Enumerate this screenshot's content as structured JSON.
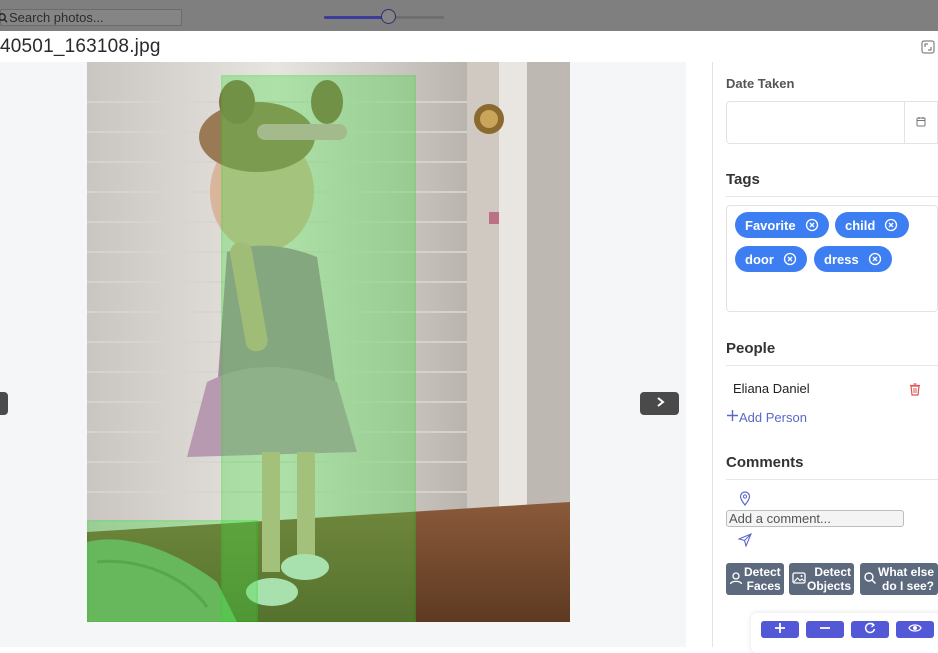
{
  "search": {
    "placeholder": "Search photos...",
    "icon": "search-icon"
  },
  "zoom": {
    "level": 0.53
  },
  "file": {
    "title": "40501_163108.jpg"
  },
  "viewer": {
    "photo_alt": "photo of a girl in a dress standing by a door",
    "detections": [
      {
        "label": "person"
      },
      {
        "label": "object"
      }
    ]
  },
  "panel": {
    "date_taken_label": "Date Taken",
    "date_value": "",
    "tags_title": "Tags",
    "tags": [
      "Favorite",
      "child",
      "door",
      "dress"
    ],
    "people_title": "People",
    "people": [
      "Eliana Daniel"
    ],
    "add_person_label": "Add Person",
    "comments_title": "Comments",
    "comment_placeholder": "Add a comment...",
    "actions": [
      {
        "line1": "Detect",
        "line2": "Faces",
        "icon": "face-icon"
      },
      {
        "line1": "Detect",
        "line2": "Objects",
        "icon": "image-icon"
      },
      {
        "line1": "What else",
        "line2": "do I see?",
        "icon": "search-icon"
      }
    ],
    "toolbar": [
      "zoom-in-icon",
      "zoom-out-icon",
      "rotate-icon",
      "eye-icon"
    ]
  },
  "colors": {
    "tag_bg": "#3d7ff2",
    "tool_bg": "#5358d6",
    "action_bg": "#5d6a7e",
    "detection_box": "#22dd22",
    "link": "#5b67c9",
    "delete": "#e05555"
  }
}
